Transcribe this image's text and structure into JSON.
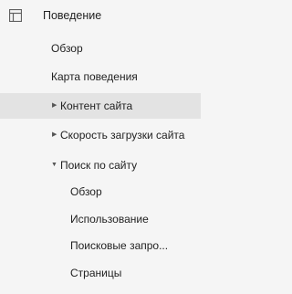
{
  "sidebar": {
    "section": {
      "icon": "layout-panel-icon",
      "label": "Поведение"
    },
    "items": [
      {
        "label": "Обзор"
      },
      {
        "label": "Карта поведения"
      },
      {
        "label": "Контент сайта",
        "expander": "collapsed",
        "selected": true
      },
      {
        "label": "Скорость загрузки сайта",
        "expander": "collapsed"
      },
      {
        "label": "Поиск по сайту",
        "expander": "expanded",
        "children": [
          {
            "label": "Обзор"
          },
          {
            "label": "Использование"
          },
          {
            "label": "Поисковые запро..."
          },
          {
            "label": "Страницы"
          }
        ]
      }
    ],
    "colors": {
      "background": "#f5f5f5",
      "selected_background": "#e3e3e3",
      "text": "#222222"
    }
  }
}
